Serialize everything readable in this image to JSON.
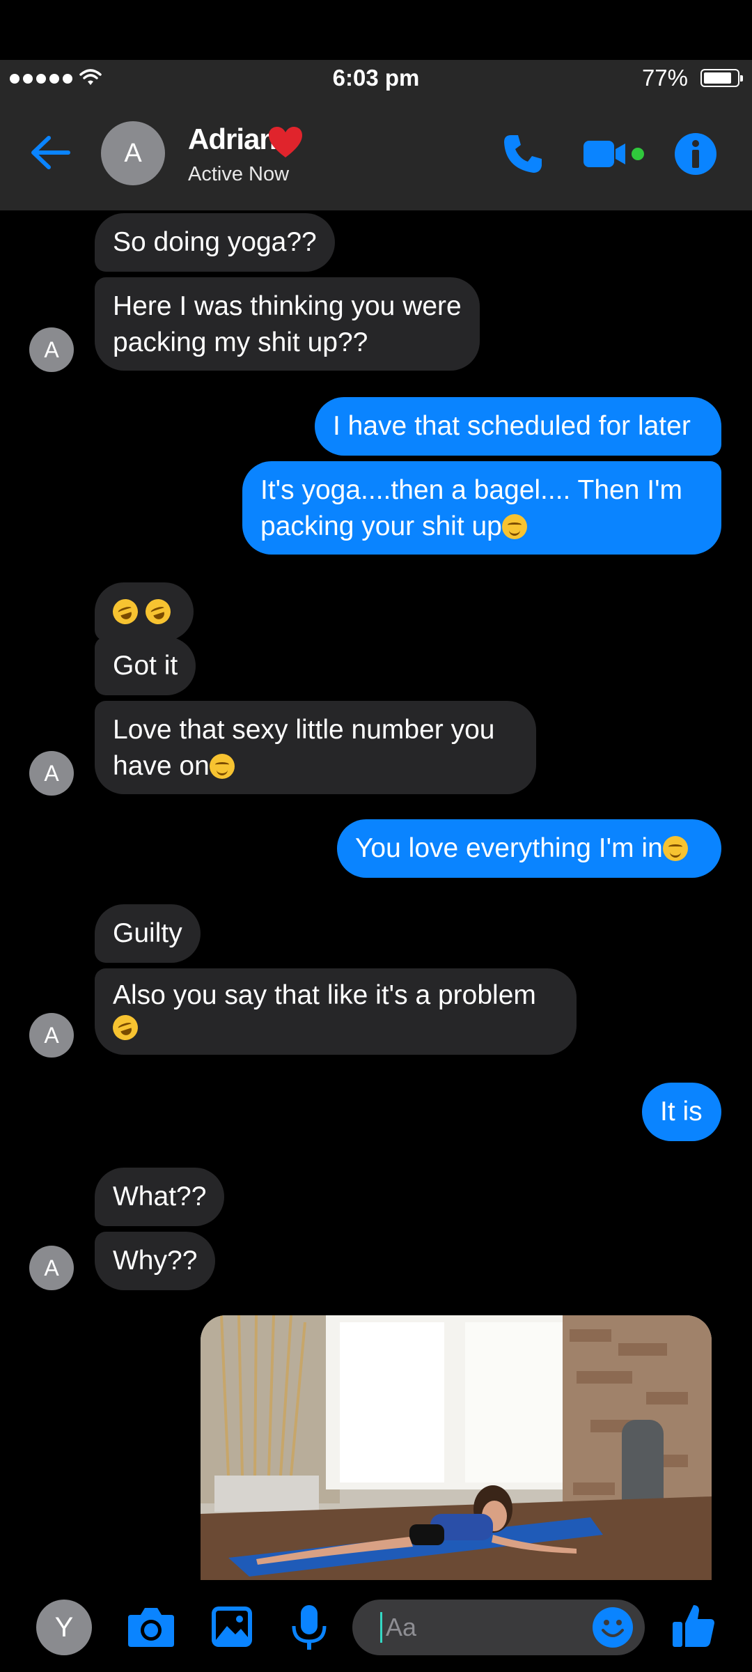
{
  "status_bar": {
    "time": "6:03 pm",
    "battery_percent": "77%",
    "battery_level": 0.77
  },
  "header": {
    "contact_name": "Adrian",
    "contact_initial": "A",
    "status": "Active Now"
  },
  "messages": [
    {
      "side": "in",
      "text": "So doing yoga??"
    },
    {
      "side": "in",
      "lines": [
        "Here I was thinking you were",
        "packing my shit up??"
      ]
    },
    {
      "side": "out",
      "text": "I have that scheduled for later"
    },
    {
      "side": "out",
      "lines": [
        "It's yoga....then a bagel.... Then I'm",
        "packing your shit up"
      ],
      "trailing_emoji": "smirk"
    },
    {
      "side": "in",
      "emoji": [
        "rolling-on-floor-laughing",
        "rolling-on-floor-laughing"
      ]
    },
    {
      "side": "in",
      "text": "Got it"
    },
    {
      "side": "in",
      "lines": [
        "Love that sexy little number you",
        "have on"
      ],
      "trailing_emoji": "smirk"
    },
    {
      "side": "out",
      "text": "You love everything I'm in",
      "trailing_emoji": "unamused"
    },
    {
      "side": "in",
      "text": "Guilty"
    },
    {
      "side": "in",
      "lines": [
        "Also you say that like it's a problem",
        ""
      ],
      "trailing_emoji": "rolling-on-floor-laughing"
    },
    {
      "side": "out",
      "text": "It is"
    },
    {
      "side": "in",
      "text": "What??"
    },
    {
      "side": "in",
      "text": "Why??"
    }
  ],
  "photo": {
    "description_icon": "image-attachment"
  },
  "composer": {
    "placeholder": "Aa",
    "user_initial": "Y"
  },
  "colors": {
    "accent": "#0a84ff",
    "incoming_bubble": "#262628",
    "header_bg": "#282828",
    "heart": "#e0242c",
    "video_dot": "#30c83c"
  }
}
